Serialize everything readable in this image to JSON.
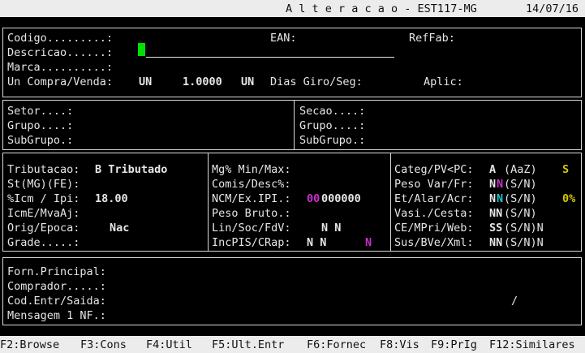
{
  "header": {
    "title": "A l t e r a c a o - EST117-MG",
    "date": "14/07/16"
  },
  "product": {
    "codigo_label": "Codigo.........:",
    "ean_label": "EAN:",
    "reffab_label": "RefFab:",
    "descricao_label": "Descricao......:",
    "marca_label": "Marca..........:",
    "uncompra_label": "Un Compra/Venda:",
    "un_compra": "UN",
    "fator": "1.0000",
    "un_venda": "UN",
    "dias_giro_label": "Dias Giro/Seg:",
    "aplic_label": "Aplic:"
  },
  "classification": {
    "setor_label": "Setor....:",
    "grupo_label": "Grupo....:",
    "subgrupo_label": "SubGrupo.:",
    "secao_label": "Secao....:",
    "grupo2_label": "Grupo....:",
    "subgrupo2_label": "SubGrupo.:"
  },
  "tax": {
    "tributacao_label": "Tributacao:",
    "tributacao_value": "B Tributado",
    "st_label": "St(MG)(FE):",
    "icm_label": "%Icm / Ipi:",
    "icm_value": "18.00",
    "icme_label": "IcmE/MvaAj:",
    "orig_label": "Orig/Epoca:",
    "orig_value": "Nac",
    "grade_label": "Grade.....:"
  },
  "margins": {
    "mg_label": "Mg% Min/Max:",
    "comis_label": "Comis/Desc%:",
    "ncm_label": "NCM/Ex.IPI.:",
    "ncm_prefix": "00",
    "ncm_rest": "000000",
    "peso_label": "Peso Bruto.:",
    "lin_label": "Lin/Soc/FdV:",
    "lin_value": "N N",
    "incpis_label": "IncPIS/CRap:",
    "incpis_value": "N N",
    "crap_value": "N"
  },
  "flags": {
    "categ_label": "Categ/PV<PC:",
    "categ_value": "A",
    "categ_hint": "(AaZ)",
    "categ_extra": "S",
    "peso_var_label": "Peso Var/Fr:",
    "peso_var_n1": "N",
    "peso_var_n2": "N",
    "peso_var_hint": "(S/N)",
    "et_label": "Et/Alar/Acr:",
    "et_n1": "N",
    "et_n2": "N",
    "et_hint": "(S/N)",
    "et_pct": "0%",
    "vasi_label": "Vasi./Cesta:",
    "vasi_value": "NN",
    "vasi_hint": "(S/N)",
    "ce_label": "CE/MPri/Web:",
    "ce_value": "SS",
    "ce_hint": "(S/N)N",
    "sus_label": "Sus/BVe/Xml:",
    "sus_value": "NN",
    "sus_hint": "(S/N)N"
  },
  "supplier": {
    "forn_label": "Forn.Principal:",
    "comprador_label": "Comprador.....:",
    "cod_entr_label": "Cod.Entr/Saida:",
    "mensagem_label": "Mensagem 1 NF.:",
    "slash": "/"
  },
  "function_keys": [
    "F2:Browse",
    "F3:Cons",
    "F4:Util",
    "F5:Ult.Entr",
    "F6:Fornec",
    "F8:Vis",
    "F9:PrIg",
    "F12:Similares"
  ]
}
